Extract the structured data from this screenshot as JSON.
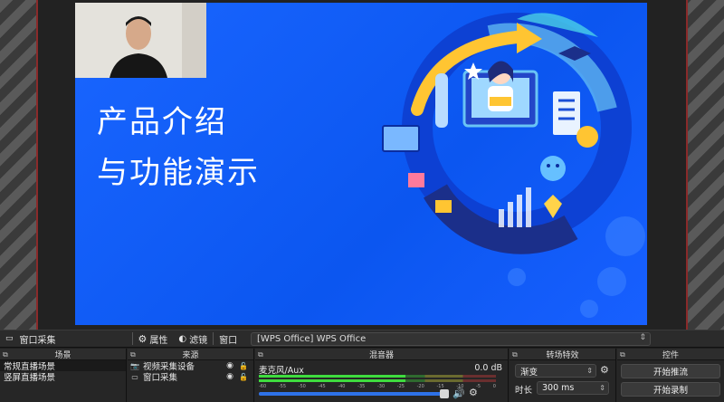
{
  "slide": {
    "title_line1": "产品介绍",
    "title_line2": "与功能演示"
  },
  "toolbar": {
    "capture_label": "窗口采集",
    "properties_label": "属性",
    "filters_label": "滤镜",
    "window_label": "窗口",
    "window_value": "[WPS Office] WPS Office"
  },
  "scenes": {
    "header": "场景",
    "items": [
      {
        "label": "常规直播场景"
      },
      {
        "label": "竖屏直播场景"
      }
    ]
  },
  "sources": {
    "header": "来源",
    "items": [
      {
        "label": "视频采集设备",
        "icon": "camera-icon"
      },
      {
        "label": "窗口采集",
        "icon": "window-icon"
      }
    ]
  },
  "mixer": {
    "header": "混音器",
    "track_name": "麦克风/Aux",
    "level": "0.0 dB",
    "meter_level_fraction": 0.62,
    "volume_fraction": 0.98,
    "scale": [
      "-60",
      "-55",
      "-50",
      "-45",
      "-40",
      "-35",
      "-30",
      "-25",
      "-20",
      "-15",
      "-10",
      "-5",
      "0"
    ]
  },
  "transitions": {
    "header": "转场特效",
    "type_value": "渐变",
    "duration_label": "时长",
    "duration_value": "300 ms"
  },
  "controls": {
    "header": "控件",
    "start_stream_label": "开始推流",
    "start_record_label": "开始录制"
  }
}
